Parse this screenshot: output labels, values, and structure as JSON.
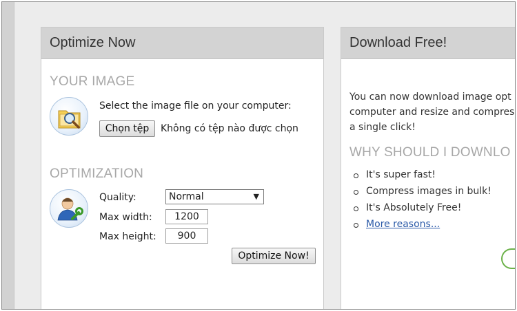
{
  "left_panel": {
    "title": "Optimize Now",
    "your_image": {
      "heading": "YOUR IMAGE",
      "prompt": "Select the image file on your computer:",
      "choose_button": "Chọn tệp",
      "no_file_text": "Không có tệp nào được chọn"
    },
    "optimization": {
      "heading": "OPTIMIZATION",
      "quality_label": "Quality:",
      "quality_value": "Normal",
      "max_width_label": "Max width:",
      "max_width_value": "1200",
      "max_height_label": "Max height:",
      "max_height_value": "900",
      "submit_button": "Optimize Now!"
    }
  },
  "right_panel": {
    "title": "Download Free!",
    "paragraph_lines": [
      "You can now download image opt",
      "computer and resize and compres",
      "a single click!"
    ],
    "why_heading": "WHY SHOULD I DOWNLO",
    "reasons": [
      "It's super fast!",
      "Compress images in bulk!",
      "It's Absolutely Free!"
    ],
    "more_link": "More reasons..."
  },
  "icons": {
    "image_icon": "folder-magnifier-icon",
    "optimization_icon": "user-wrench-icon",
    "dropdown_icon": "dropdown-arrow-icon"
  }
}
